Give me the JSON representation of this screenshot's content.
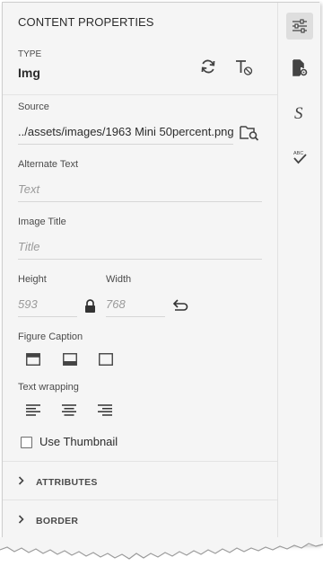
{
  "panel": {
    "title": "CONTENT PROPERTIES",
    "type_label": "TYPE",
    "type_value": "Img",
    "source_label": "Source",
    "source_value": "../assets/images/1963 Mini 50percent.png",
    "alt_label": "Alternate Text",
    "alt_placeholder": "Text",
    "image_title_label": "Image Title",
    "image_title_placeholder": "Title",
    "height_label": "Height",
    "height_placeholder": "593",
    "width_label": "Width",
    "width_placeholder": "768",
    "figure_caption_label": "Figure Caption",
    "text_wrapping_label": "Text wrapping",
    "use_thumbnail_label": "Use Thumbnail",
    "attributes_label": "ATTRIBUTES",
    "border_label": "BORDER"
  },
  "rail": {
    "items": [
      "sliders-icon",
      "document-settings-icon",
      "style-icon",
      "spellcheck-icon"
    ],
    "active": "sliders-icon"
  },
  "icons": {
    "type_actions": [
      "refresh-icon",
      "clear-format-icon"
    ],
    "source_browse": "browse-folder-icon",
    "lock": "lock-icon",
    "reset": "undo-icon",
    "caption_options": [
      "caption-top-icon",
      "caption-bottom-icon",
      "caption-none-icon"
    ],
    "wrap_options": [
      "align-left-icon",
      "align-center-icon",
      "align-right-icon"
    ],
    "accordion": "chevron-right-icon"
  },
  "colors": {
    "panel_bg": "#f5f5f5",
    "text": "#2c2c2c",
    "muted": "#9a9a9a",
    "active_rail": "#dedede"
  }
}
